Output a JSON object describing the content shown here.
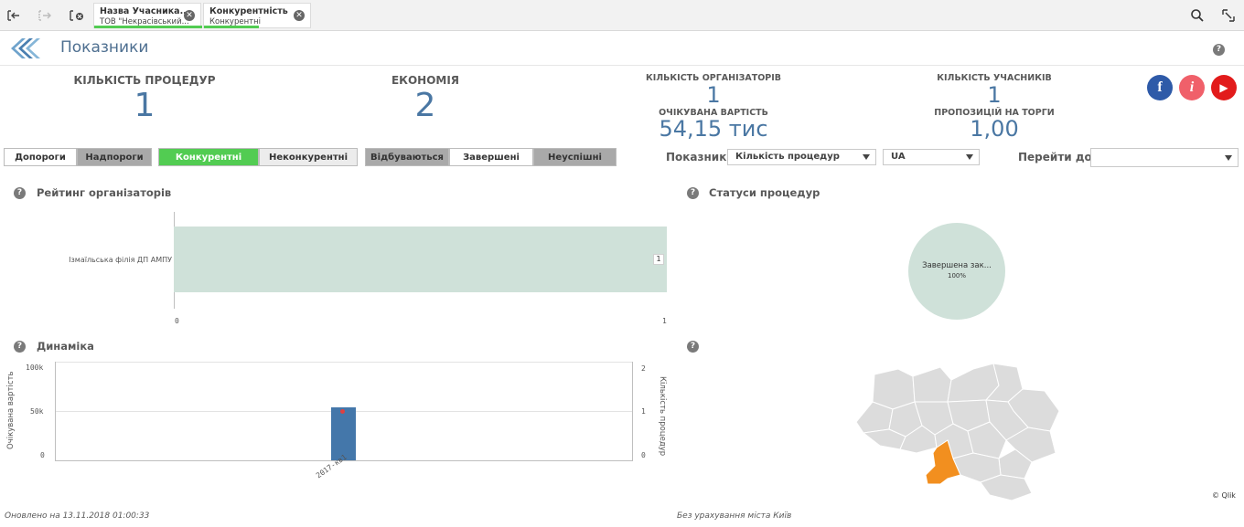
{
  "selections": {
    "chips": [
      {
        "title": "Назва Учасника...",
        "value": "ТОВ \"Некрасівський..."
      },
      {
        "title": "Конкурентність",
        "value": "Конкурентні"
      }
    ]
  },
  "header": {
    "title": "Показники",
    "help": "?"
  },
  "kpis": {
    "procedures_label": "КІЛЬКІСТЬ ПРОЦЕДУР",
    "procedures_value": "1",
    "economy_label": "ЕКОНОМІЯ",
    "economy_value": "2",
    "organizers_label": "КІЛЬКІСТЬ ОРГАНІЗАТОРІВ",
    "organizers_value": "1",
    "expected_label": "ОЧІКУВАНА ВАРТІСТЬ",
    "expected_value": "54,15 тис",
    "participants_label": "КІЛЬКІСТЬ УЧАСНИКІВ",
    "participants_value": "1",
    "proposals_label": "ПРОПОЗИЦІЙ НА ТОРГИ",
    "proposals_value": "1,00"
  },
  "social": {
    "facebook": "f",
    "info": "i",
    "youtube": "▶"
  },
  "filters": {
    "below_threshold": "Допороги",
    "above_threshold": "Надпороги",
    "competitive": "Конкурентні",
    "noncompetitive": "Неконкурентні",
    "ongoing": "Відбуваються",
    "completed": "Завершені",
    "failed": "Неуспішні"
  },
  "controls": {
    "indicator_label": "Показник",
    "indicator_value": "Кількість процедур",
    "region_value": "UA",
    "goto_label": "Перейти до",
    "goto_value": ""
  },
  "panels": {
    "rating_title": "Рейтинг організаторів",
    "statuses_title": "Статуси процедур",
    "dynamics_title": "Динаміка",
    "help": "?"
  },
  "chart_data": [
    {
      "type": "bar",
      "orientation": "horizontal",
      "categories": [
        "Ізмаїльська філія ДП АМПУ"
      ],
      "values": [
        1
      ],
      "data_labels": [
        "1"
      ],
      "xlim": [
        0,
        1
      ],
      "x_ticks": [
        "0",
        "1"
      ]
    },
    {
      "type": "pie",
      "slices": [
        {
          "label": "Завершена зак...",
          "value": 100,
          "display": "100%"
        }
      ]
    },
    {
      "type": "bar",
      "categories": [
        "2017-кв1"
      ],
      "series": [
        {
          "values": [
            54150
          ],
          "color": "#4477aa",
          "axis": "left"
        },
        {
          "values": [
            1
          ],
          "color": "#e04040",
          "axis": "right",
          "mark": "point"
        }
      ],
      "ylabel": "Очікувана вартість",
      "y2label": "Кількість процедур",
      "ylim": [
        0,
        100000
      ],
      "y2lim": [
        0,
        2
      ],
      "y_ticks": [
        "100k",
        "50k",
        "0"
      ],
      "y2_ticks": [
        "2",
        "1",
        "0"
      ]
    }
  ],
  "map": {
    "credit": "© Qlik",
    "highlight_color": "#f28f1f",
    "base_color": "#dcdcdc"
  },
  "footer": {
    "updated": "Оновлено на 13.11.2018 01:00:33",
    "note": "Без урахування міста Київ"
  }
}
